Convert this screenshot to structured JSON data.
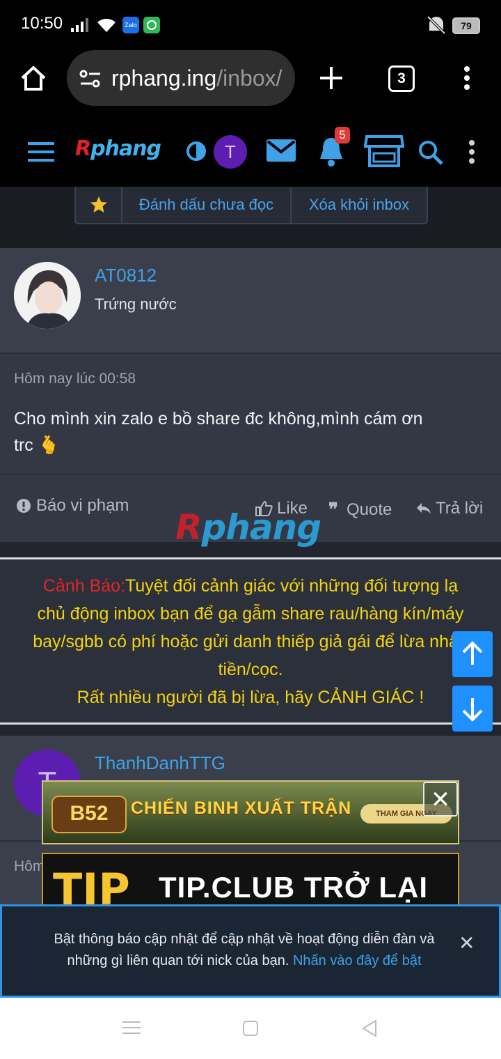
{
  "status_bar": {
    "time": "10:50",
    "battery": "79",
    "apps": [
      "Zalo",
      "zalo-chat"
    ]
  },
  "browser": {
    "url_host": "rphang.ing",
    "url_path": "/inbox/",
    "tab_count": "3"
  },
  "site_header": {
    "logo_r": "R",
    "logo_rest": "phang",
    "avatar_letter": "T",
    "notification_count": "5"
  },
  "actions": {
    "mark_unread": "Đánh dấu chưa đọc",
    "remove": "Xóa khỏi inbox"
  },
  "message": {
    "username": "AT0812",
    "role": "Trứng nước",
    "timestamp": "Hôm nay lúc 00:58",
    "body_line1": "Cho mình xin zalo e bồ share đc không,mình cám ơn",
    "body_line2": "trc 🫰",
    "report": "Báo vi phạm",
    "like": "Like",
    "quote": "Quote",
    "reply": "Trả lời"
  },
  "watermark": {
    "r": "R",
    "rest": "phang"
  },
  "warning": {
    "label": "Cảnh Báo:",
    "line1": "Tuyệt đối cảnh giác với những đối tượng lạ",
    "line2": "chủ động inbox bạn để gạ gẫm share rau/hàng kín/máy",
    "line3": "bay/sgbb có phí hoặc gửi danh thiếp giả gái để lừa nhận",
    "line4": "tiền/cọc.",
    "line5": "Rất nhiều người đã bị lừa, hãy CẢNH GIÁC !"
  },
  "message2": {
    "username": "ThanhDanhTTG",
    "avatar_letter": "T",
    "timestamp_partial": "Hôm"
  },
  "ads": {
    "ad1_brand": "B52",
    "ad1_title": "CHIẾN BINH XUẤT TRẬN",
    "ad1_cta": "THAM GIA NGAY",
    "ad2_brand": "TIP",
    "ad2_title": "TIP.CLUB TRỞ LẠI"
  },
  "notification": {
    "text_line1": "Bật thông báo cập nhật để cập nhật về hoạt động diễn đàn và",
    "text_line2": "những gì liên quan tới nick của bạn.",
    "link": "Nhấn vào đây để bật"
  },
  "colors": {
    "accent": "#3fa1e8",
    "warning_text": "#f2d312",
    "warning_label": "#e2242b",
    "scroll_button": "#1e90ff"
  }
}
